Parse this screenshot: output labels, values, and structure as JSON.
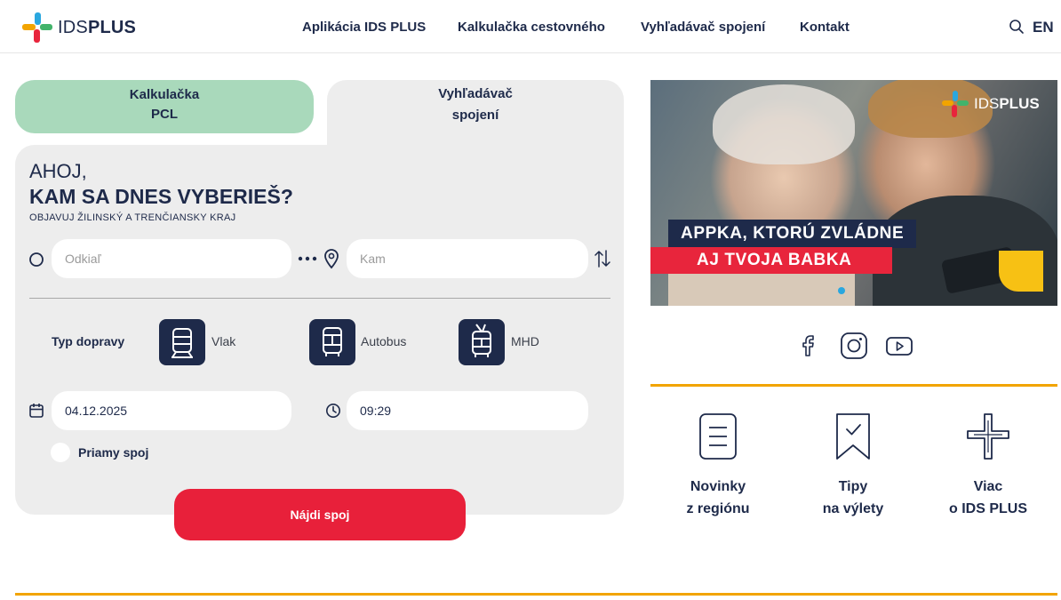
{
  "header": {
    "logo": {
      "prefix": "IDS",
      "suffix": "PLUS"
    },
    "nav": [
      "Aplikácia IDS PLUS",
      "Kalkulačka cestovného",
      "Vyhľadávač spojení",
      "Kontakt"
    ],
    "search_icon": "search-icon",
    "language": "EN"
  },
  "tabs": {
    "calculator": {
      "line1": "Kalkulačka",
      "line2": "PCL"
    },
    "search": {
      "line1": "Vyhľadávač",
      "line2": "spojení"
    }
  },
  "planner": {
    "greeting": "AHOJ,",
    "headline": "KAM SA DNES VYBERIEŠ?",
    "subline": "OBJAVUJ ŽILINSKÝ A TRENČIANSKY KRAJ",
    "from_placeholder": "Odkiaľ",
    "to_placeholder": "Kam",
    "transport_label": "Typ dopravy",
    "transport_types": [
      {
        "label": "Vlak",
        "icon": "train-icon"
      },
      {
        "label": "Autobus",
        "icon": "bus-icon"
      },
      {
        "label": "MHD",
        "icon": "trolleybus-icon"
      }
    ],
    "date": "04.12.2025",
    "time": "09:29",
    "direct_label": "Priamy spoj",
    "find_button": "Nájdi spoj"
  },
  "banner": {
    "logo": {
      "prefix": "IDS",
      "suffix": "PLUS"
    },
    "line1": "APPKA, KTORÚ ZVLÁDNE",
    "line2": "AJ TVOJA BABKA"
  },
  "social": [
    "facebook-icon",
    "instagram-icon",
    "youtube-icon"
  ],
  "tiles": [
    {
      "line1": "Novinky",
      "line2": "z regiónu",
      "icon": "document-icon"
    },
    {
      "line1": "Tipy",
      "line2": "na výlety",
      "icon": "bookmark-check-icon"
    },
    {
      "line1": "Viac",
      "line2": "o IDS PLUS",
      "icon": "ids-logo-outline-icon"
    }
  ],
  "colors": {
    "navy": "#1e2a4a",
    "red": "#e8203a",
    "mint": "#a9d9bb",
    "panel": "#ededed",
    "yellow": "#f2a400"
  }
}
